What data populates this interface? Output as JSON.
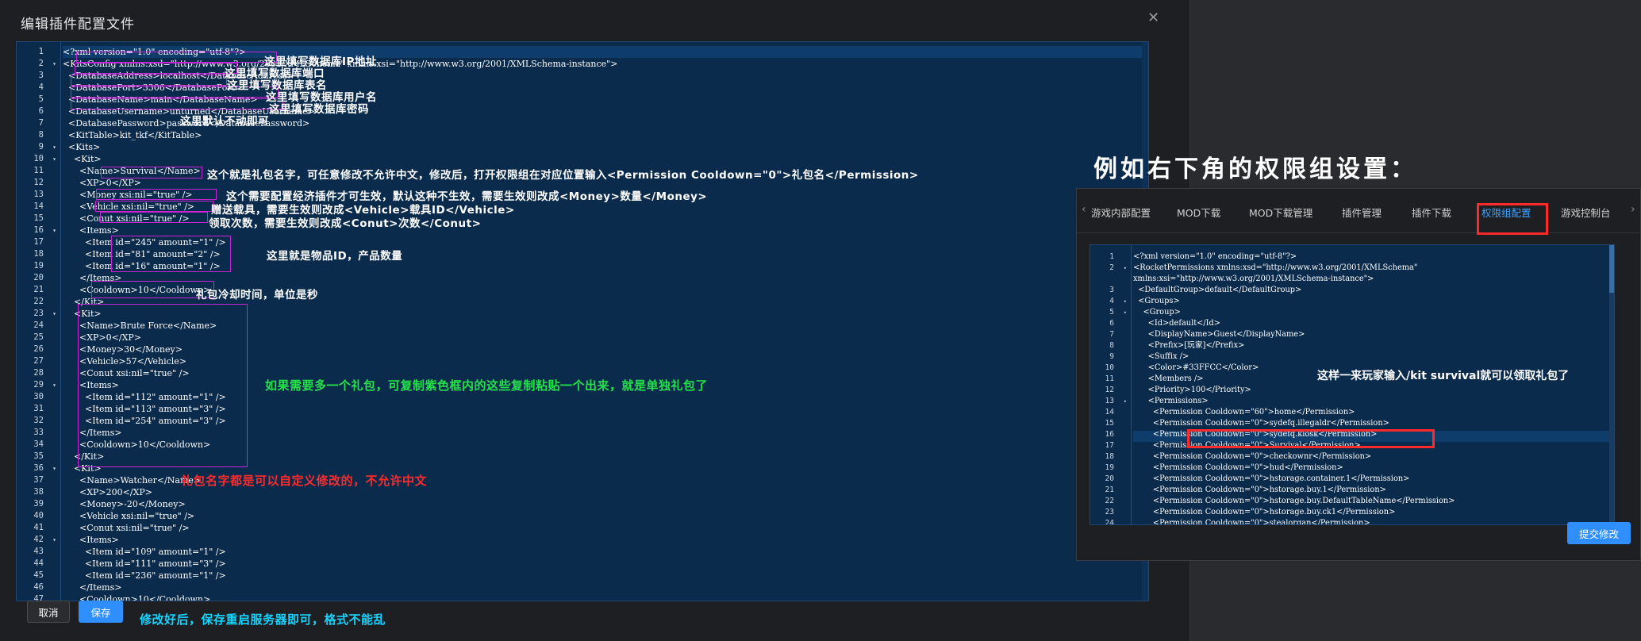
{
  "modal": {
    "title": "编辑插件配置文件",
    "close_icon": "close-icon",
    "cancel_label": "取消",
    "save_label": "保存"
  },
  "editor": {
    "lines": [
      {
        "n": "1",
        "f": "",
        "text": "<?xml version=\"1.0\" encoding=\"utf-8\"?>"
      },
      {
        "n": "2",
        "f": "▾",
        "text": "<KitsConfig xmlns:xsd=\"http://www.w3.org/2001/XMLSchema\" xmlns:xsi=\"http://www.w3.org/2001/XMLSchema-instance\">"
      },
      {
        "n": "3",
        "f": "",
        "text": "  <DatabaseAddress>localhost</DatabaseAddress>"
      },
      {
        "n": "4",
        "f": "",
        "text": "  <DatabasePort>3306</DatabasePort>"
      },
      {
        "n": "5",
        "f": "",
        "text": "  <DatabaseName>main</DatabaseName>"
      },
      {
        "n": "6",
        "f": "",
        "text": "  <DatabaseUsername>unturned</DatabaseUsername>"
      },
      {
        "n": "7",
        "f": "",
        "text": "  <DatabasePassword>password</DatabasePassword>"
      },
      {
        "n": "8",
        "f": "",
        "text": "  <KitTable>kit_tkf</KitTable>"
      },
      {
        "n": "9",
        "f": "▾",
        "text": "  <Kits>"
      },
      {
        "n": "10",
        "f": "▾",
        "text": "    <Kit>"
      },
      {
        "n": "11",
        "f": "",
        "text": "      <Name>Survival</Name>"
      },
      {
        "n": "12",
        "f": "",
        "text": "      <XP>0</XP>"
      },
      {
        "n": "13",
        "f": "",
        "text": "      <Money xsi:nil=\"true\" />"
      },
      {
        "n": "14",
        "f": "",
        "text": "      <Vehicle xsi:nil=\"true\" />"
      },
      {
        "n": "15",
        "f": "",
        "text": "      <Conut xsi:nil=\"true\" />"
      },
      {
        "n": "16",
        "f": "▾",
        "text": "      <Items>"
      },
      {
        "n": "17",
        "f": "",
        "text": "        <Item id=\"245\" amount=\"1\" />"
      },
      {
        "n": "18",
        "f": "",
        "text": "        <Item id=\"81\" amount=\"2\" />"
      },
      {
        "n": "19",
        "f": "",
        "text": "        <Item id=\"16\" amount=\"1\" />"
      },
      {
        "n": "20",
        "f": "",
        "text": "      </Items>"
      },
      {
        "n": "21",
        "f": "",
        "text": "      <Cooldown>10</Cooldown>"
      },
      {
        "n": "22",
        "f": "",
        "text": "    </Kit>"
      },
      {
        "n": "23",
        "f": "▾",
        "text": "    <Kit>"
      },
      {
        "n": "24",
        "f": "",
        "text": "      <Name>Brute Force</Name>"
      },
      {
        "n": "25",
        "f": "",
        "text": "      <XP>0</XP>"
      },
      {
        "n": "26",
        "f": "",
        "text": "      <Money>30</Money>"
      },
      {
        "n": "27",
        "f": "",
        "text": "      <Vehicle>57</Vehicle>"
      },
      {
        "n": "28",
        "f": "",
        "text": "      <Conut xsi:nil=\"true\" />"
      },
      {
        "n": "29",
        "f": "▾",
        "text": "      <Items>"
      },
      {
        "n": "30",
        "f": "",
        "text": "        <Item id=\"112\" amount=\"1\" />"
      },
      {
        "n": "31",
        "f": "",
        "text": "        <Item id=\"113\" amount=\"3\" />"
      },
      {
        "n": "32",
        "f": "",
        "text": "        <Item id=\"254\" amount=\"3\" />"
      },
      {
        "n": "33",
        "f": "",
        "text": "      </Items>"
      },
      {
        "n": "34",
        "f": "",
        "text": "      <Cooldown>10</Cooldown>"
      },
      {
        "n": "35",
        "f": "",
        "text": "    </Kit>"
      },
      {
        "n": "36",
        "f": "▾",
        "text": "    <Kit>"
      },
      {
        "n": "37",
        "f": "",
        "text": "      <Name>Watcher</Name>"
      },
      {
        "n": "38",
        "f": "",
        "text": "      <XP>200</XP>"
      },
      {
        "n": "39",
        "f": "",
        "text": "      <Money>-20</Money>"
      },
      {
        "n": "40",
        "f": "",
        "text": "      <Vehicle xsi:nil=\"true\" />"
      },
      {
        "n": "41",
        "f": "",
        "text": "      <Conut xsi:nil=\"true\" />"
      },
      {
        "n": "42",
        "f": "▾",
        "text": "      <Items>"
      },
      {
        "n": "43",
        "f": "",
        "text": "        <Item id=\"109\" amount=\"1\" />"
      },
      {
        "n": "44",
        "f": "",
        "text": "        <Item id=\"111\" amount=\"3\" />"
      },
      {
        "n": "45",
        "f": "",
        "text": "        <Item id=\"236\" amount=\"1\" />"
      },
      {
        "n": "46",
        "f": "",
        "text": "      </Items>"
      },
      {
        "n": "47",
        "f": "",
        "text": "      <Cooldown>10</Cooldown>"
      }
    ]
  },
  "annotations": {
    "db_ip": "这里填写数据库IP地址",
    "db_port": "这里填写数据库端口",
    "db_name": "这里填写数据库表名",
    "db_user": "这里填写数据库用户名",
    "db_pass": "这里填写数据库密码",
    "kit_table": "这里默认不动即可",
    "kit_name": "这个就是礼包名字，可任意修改不允许中文，修改后，打开权限组在对应位置输入<Permission Cooldown=\"0\">礼包名</Permission>",
    "money": "这个需要配置经济插件才可生效，默认这种不生效，需要生效则改成<Money>数量</Money>",
    "vehicle": "赠送载具，需要生效则改成<Vehicle>载具ID</Vehicle>",
    "conut": "领取次数，需要生效则改成<Conut>次数</Conut>",
    "items": "这里就是物品ID，产品数量",
    "cooldown": "礼包冷却时间，单位是秒",
    "copy_kit": "如果需要多一个礼包，可复制紫色框内的这些复制粘贴一个出来，就是单独礼包了",
    "name_rule": "礼包名字都是可以自定义修改的，不允许中文",
    "save_note": "修改好后，保存重启服务器即可，格式不能乱",
    "example_title": "例如右下角的权限组设置："
  },
  "inset": {
    "tabs": [
      "游戏内部配置",
      "MOD下载",
      "MOD下载管理",
      "插件管理",
      "插件下载",
      "权限组配置",
      "游戏控制台"
    ],
    "active_tab": "权限组配置",
    "submit_label": "提交修改",
    "note": "这样一来玩家输入/kit survival就可以领取礼包了",
    "lines": [
      {
        "n": "1",
        "f": "",
        "text": "<?xml version=\"1.0\" encoding=\"utf-8\"?>"
      },
      {
        "n": "2",
        "f": "▾",
        "text": "<RocketPermissions xmlns:xsd=\"http://www.w3.org/2001/XMLSchema\""
      },
      {
        "n": "",
        "f": "",
        "text": "xmlns:xsi=\"http://www.w3.org/2001/XMLSchema-instance\">"
      },
      {
        "n": "3",
        "f": "",
        "text": "  <DefaultGroup>default</DefaultGroup>"
      },
      {
        "n": "4",
        "f": "▾",
        "text": "  <Groups>"
      },
      {
        "n": "5",
        "f": "▾",
        "text": "    <Group>"
      },
      {
        "n": "6",
        "f": "",
        "text": "      <Id>default</Id>"
      },
      {
        "n": "7",
        "f": "",
        "text": "      <DisplayName>Guest</DisplayName>"
      },
      {
        "n": "8",
        "f": "",
        "text": "      <Prefix>[玩家]</Prefix>"
      },
      {
        "n": "9",
        "f": "",
        "text": "      <Suffix />"
      },
      {
        "n": "10",
        "f": "",
        "text": "      <Color>#33FFCC</Color>"
      },
      {
        "n": "11",
        "f": "",
        "text": "      <Members />"
      },
      {
        "n": "12",
        "f": "",
        "text": "      <Priority>100</Priority>"
      },
      {
        "n": "13",
        "f": "▾",
        "text": "      <Permissions>"
      },
      {
        "n": "14",
        "f": "",
        "text": "        <Permission Cooldown=\"60\">home</Permission>"
      },
      {
        "n": "15",
        "f": "",
        "text": "        <Permission Cooldown=\"0\">sydefq.illegaldr</Permission>"
      },
      {
        "n": "16",
        "f": "",
        "text": "        <Permission Cooldown=\"0\">sydefq.kiosk</Permission>"
      },
      {
        "n": "17",
        "f": "",
        "text": "        <Permission Cooldown=\"0\">Survival</Permission>"
      },
      {
        "n": "18",
        "f": "",
        "text": "        <Permission Cooldown=\"0\">checkownr</Permission>"
      },
      {
        "n": "19",
        "f": "",
        "text": "        <Permission Cooldown=\"0\">hud</Permission>"
      },
      {
        "n": "20",
        "f": "",
        "text": "        <Permission Cooldown=\"0\">hstorage.container.1</Permission>"
      },
      {
        "n": "21",
        "f": "",
        "text": "        <Permission Cooldown=\"0\">hstorage.buy.1</Permission>"
      },
      {
        "n": "22",
        "f": "",
        "text": "        <Permission Cooldown=\"0\">hstorage.buy.DefaultTableName</Permission>"
      },
      {
        "n": "23",
        "f": "",
        "text": "        <Permission Cooldown=\"0\">hstorage.buy.ck1</Permission>"
      },
      {
        "n": "24",
        "f": "",
        "text": "        <Permission Cooldown=\"0\">stealorgan</Permission>"
      }
    ]
  }
}
